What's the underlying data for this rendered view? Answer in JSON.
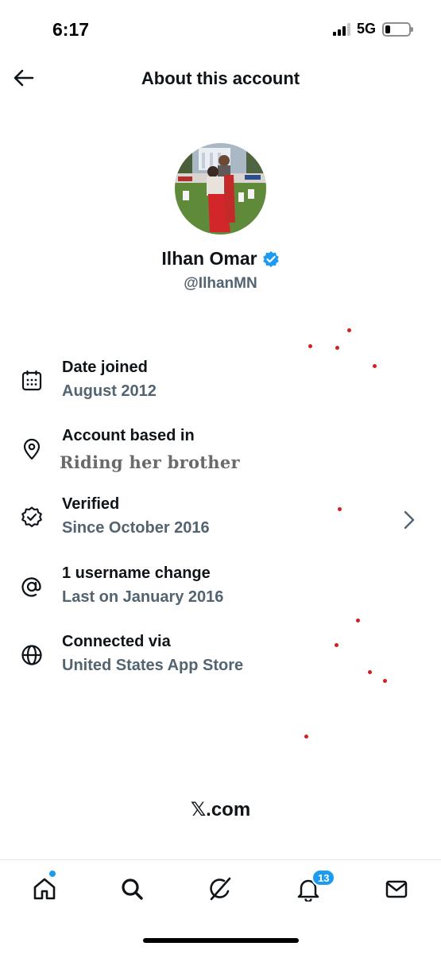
{
  "status_bar": {
    "time": "6:17",
    "network": "5G",
    "battery_level": 0.2
  },
  "header": {
    "title": "About this account",
    "back_icon": "arrow-left-icon"
  },
  "profile": {
    "name": "Ilhan Omar",
    "handle": "@IlhanMN",
    "verified_icon": "verified-badge-icon",
    "verified_color": "#1d9bf0"
  },
  "info_rows": [
    {
      "icon": "calendar-icon",
      "label": "Date joined",
      "value": "August 2012"
    },
    {
      "icon": "location-pin-icon",
      "label": "Account based in",
      "value": "Riding her brother"
    },
    {
      "icon": "verified-seal-icon",
      "label": "Verified",
      "value": "Since October 2016"
    },
    {
      "icon": "at-sign-icon",
      "label": "1 username change",
      "value": "Last on January 2016"
    },
    {
      "icon": "globe-icon",
      "label": "Connected via",
      "value": "United States App Store"
    }
  ],
  "footer": {
    "brand": "𝕏.com"
  },
  "tab_bar": {
    "items": [
      {
        "icon": "home-icon",
        "name": "home"
      },
      {
        "icon": "search-icon",
        "name": "search"
      },
      {
        "icon": "grok-icon",
        "name": "grok"
      },
      {
        "icon": "bell-icon",
        "name": "notifications"
      },
      {
        "icon": "mail-icon",
        "name": "messages"
      }
    ],
    "notification_count": "13"
  },
  "colors": {
    "text_primary": "#0f1419",
    "text_secondary": "#536471",
    "accent": "#1d9bf0",
    "annotation_dot": "#d41f1f"
  }
}
